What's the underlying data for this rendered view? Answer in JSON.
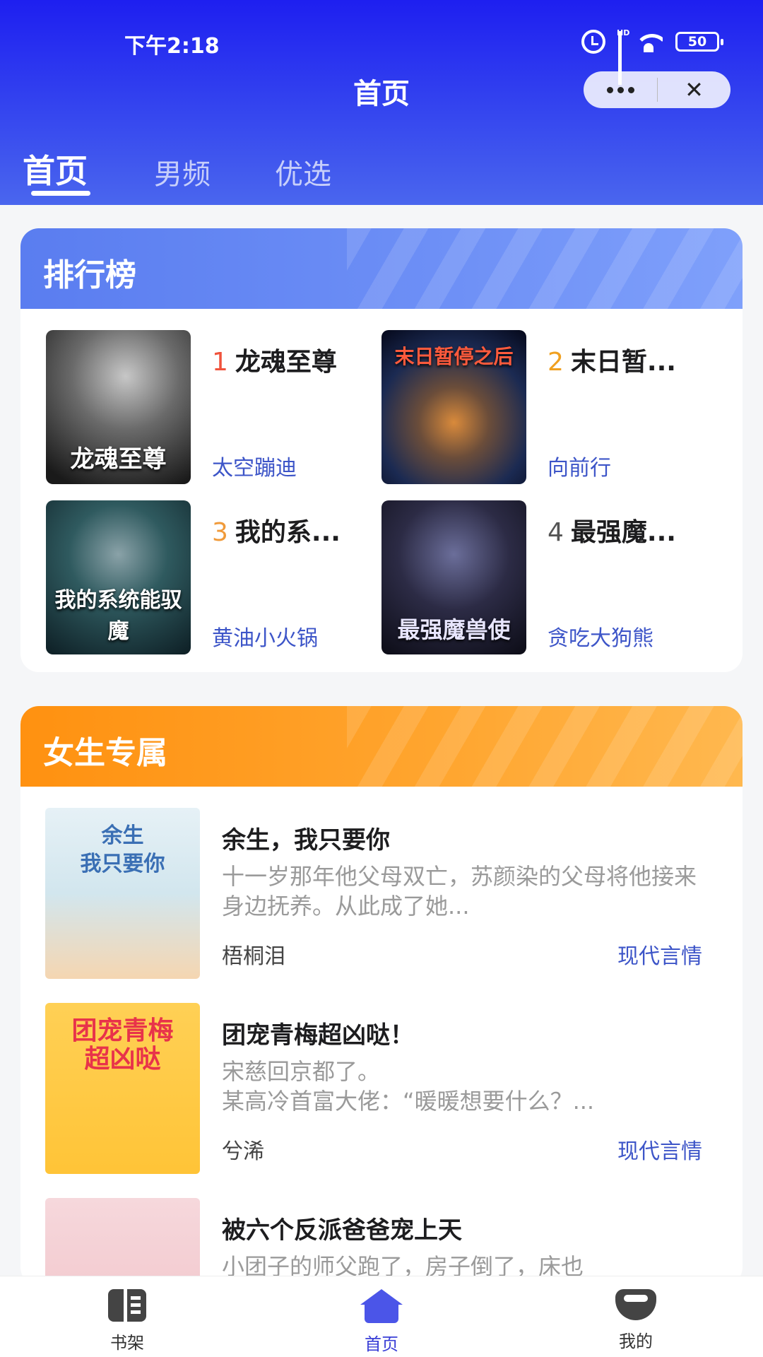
{
  "status_bar": {
    "time": "下午2:18",
    "signal_label": "HD",
    "battery": "50"
  },
  "header": {
    "title": "首页",
    "close_symbol": "✕"
  },
  "tabs": [
    {
      "label": "首页",
      "active": true
    },
    {
      "label": "男频",
      "active": false
    },
    {
      "label": "优选",
      "active": false
    }
  ],
  "ranking": {
    "title": "排行榜",
    "items": [
      {
        "rank": "1",
        "title": "龙魂至尊",
        "author": "太空蹦迪",
        "cover_text": "龙魂至尊",
        "rank_color": "#f0533c"
      },
      {
        "rank": "2",
        "title": "末日暂...",
        "author": "向前行",
        "cover_text": "末日暂停之后",
        "rank_color": "#f0a020"
      },
      {
        "rank": "3",
        "title": "我的系...",
        "author": "黄油小火锅",
        "cover_text": "我的系统能驭魔",
        "rank_color": "#f09a3a"
      },
      {
        "rank": "4",
        "title": "最强魔...",
        "author": "贪吃大狗熊",
        "cover_text": "最强魔兽使",
        "rank_color": "#555555"
      }
    ]
  },
  "girls": {
    "title": "女生专属",
    "books": [
      {
        "title": "余生，我只要你",
        "desc": "十一岁那年他父母双亡，苏颜染的父母将他接来身边抚养。从此成了她...",
        "author": "梧桐泪",
        "tag": "现代言情",
        "cover_text": "余生\n我只要你"
      },
      {
        "title": "团宠青梅超凶哒！",
        "desc": "宋慈回京都了。\n某高冷首富大佬：“暖暖想要什么？...",
        "author": "兮浠",
        "tag": "现代言情",
        "cover_text": "团宠青梅\n超凶哒"
      },
      {
        "title": "被六个反派爸爸宠上天",
        "desc": "小团子的师父跑了，房子倒了，床也",
        "author": "",
        "tag": "",
        "cover_text": ""
      }
    ]
  },
  "bottom_nav": [
    {
      "label": "书架",
      "icon": "bookshelf-icon",
      "active": false
    },
    {
      "label": "首页",
      "icon": "home-icon",
      "active": true
    },
    {
      "label": "我的",
      "icon": "profile-icon",
      "active": false
    }
  ],
  "colors": {
    "header_blue": "#2430ef",
    "accent_blue": "#3d55c8",
    "orange": "#ff9110"
  }
}
